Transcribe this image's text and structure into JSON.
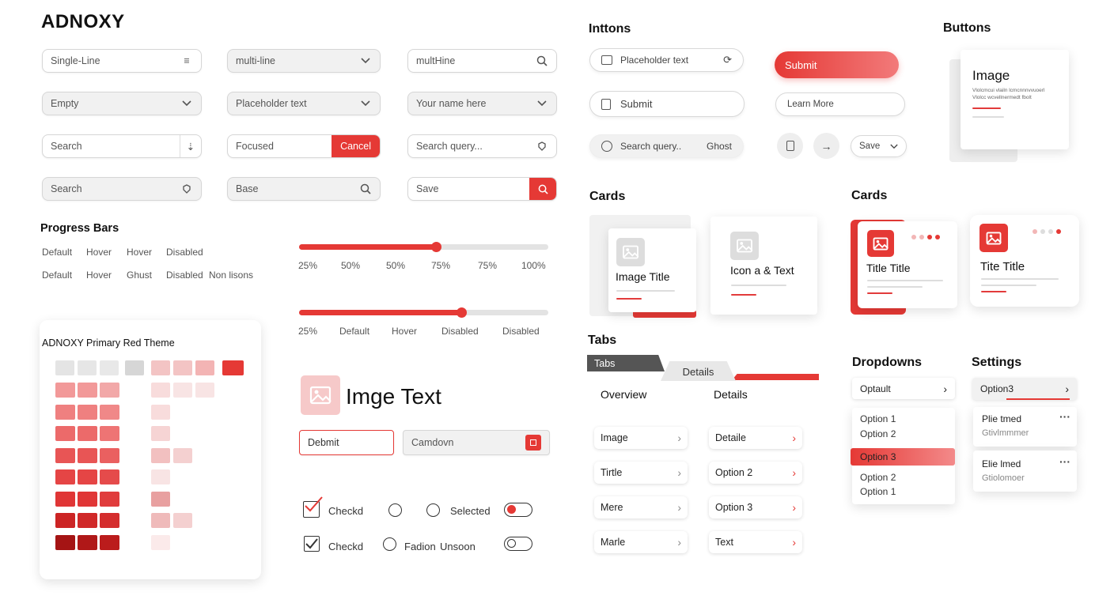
{
  "brand": "ADNOXY",
  "colors": {
    "accent": "#e53935",
    "accent_light": "#f6b7b7",
    "gray": "#f1f1f1"
  },
  "inputs": {
    "row1": [
      "Single-Line",
      "multi-line",
      "multHine"
    ],
    "row2": [
      "Empty",
      "Placeholder text",
      "Your name here"
    ],
    "row3": {
      "a": "Search",
      "b": "Focused",
      "b_button": "Cancel",
      "c": "Search query..."
    },
    "row4": [
      "Search",
      "Base",
      "Save"
    ]
  },
  "progress": {
    "title": "Progress Bars",
    "row1": [
      "Default",
      "Hover",
      "Hover",
      "Disabled"
    ],
    "row2": [
      "Default",
      "Hover",
      "Ghust",
      "Disabled",
      "Non lisons"
    ],
    "slider1": {
      "value": 0.55,
      "ticks": [
        "25%",
        "50%",
        "50%",
        "75%",
        "75%",
        "100%"
      ]
    },
    "slider2": {
      "value": 0.65,
      "ticks": [
        "25%",
        "Default",
        "Hover",
        "Disabled",
        "Disabled"
      ]
    }
  },
  "theme": {
    "title": "ADNOXY Primary Red Theme"
  },
  "image_text": {
    "title": "Imge Text",
    "field1": "Debmit",
    "field2": "Camdovn"
  },
  "checks": {
    "row1": {
      "check": "Checkd",
      "radio": "Selected"
    },
    "row2": {
      "check": "Checkd",
      "radio": "Fadion",
      "radio2": "Unsoon"
    }
  },
  "buttons_left": {
    "title": "Inttons",
    "placeholder": "Placeholder text",
    "submit": "Submit",
    "search": "Search query..",
    "ghost": "Ghost"
  },
  "buttons_mid": {
    "submit": "Submit",
    "learn": "Learn More",
    "save": "Save"
  },
  "buttons_right": {
    "title": "Buttons",
    "card_title": "Image",
    "card_sub1": "Vlolcmcui vlailn lcmcnnnvvuoerl",
    "card_sub2": "Vlolcc wcvellnermedt fbolt"
  },
  "cards_left": {
    "title": "Cards",
    "card1": "Image Title",
    "card2": "Icon a & Text"
  },
  "cards_right": {
    "title": "Cards",
    "card1": "Title Title",
    "card2": "Tite Title"
  },
  "tabs": {
    "title": "Tabs",
    "tab1": "Tabs",
    "tab2": "Details",
    "col1_head": "Overview",
    "col2_head": "Details",
    "col1": [
      "Image",
      "Tirtle",
      "Mere",
      "Marle"
    ],
    "col2": [
      "Detaile",
      "Option 2",
      "Option 3",
      "Text"
    ]
  },
  "dropdowns": {
    "title": "Dropdowns",
    "select": "Optault",
    "menu1": [
      "Option 1",
      "Option 2"
    ],
    "selected": "Option 3",
    "menu2": [
      "Option 2",
      "Option 1"
    ]
  },
  "settings": {
    "title": "Settings",
    "select": "Option3",
    "items": [
      {
        "title": "Plie tmed",
        "sub": "Gtivlmmmer"
      },
      {
        "title": "Elie lmed",
        "sub": "Gtiolomoer"
      }
    ]
  }
}
